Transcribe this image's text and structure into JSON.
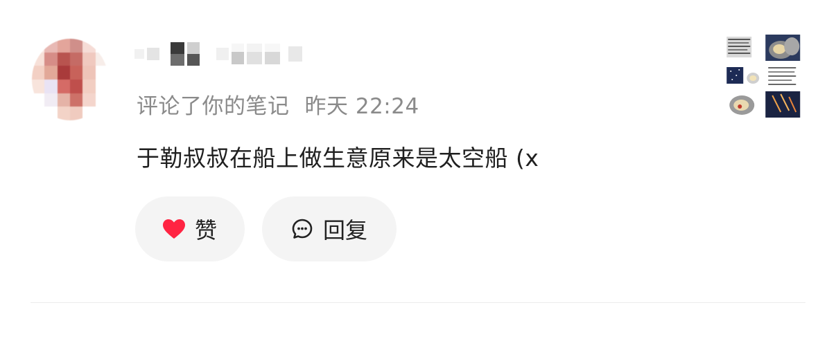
{
  "notification": {
    "meta_action": "评论了你的笔记",
    "meta_time": "昨天 22:24",
    "comment_text": "于勒叔叔在船上做生意原来是太空船 (x"
  },
  "actions": {
    "like_label": "赞",
    "reply_label": "回复"
  },
  "colors": {
    "like_heart": "#ff2442",
    "meta_text": "#8a8a8a",
    "button_bg": "#f4f4f4"
  },
  "icons": {
    "like": "heart-icon",
    "reply": "comment-bubble-icon"
  }
}
